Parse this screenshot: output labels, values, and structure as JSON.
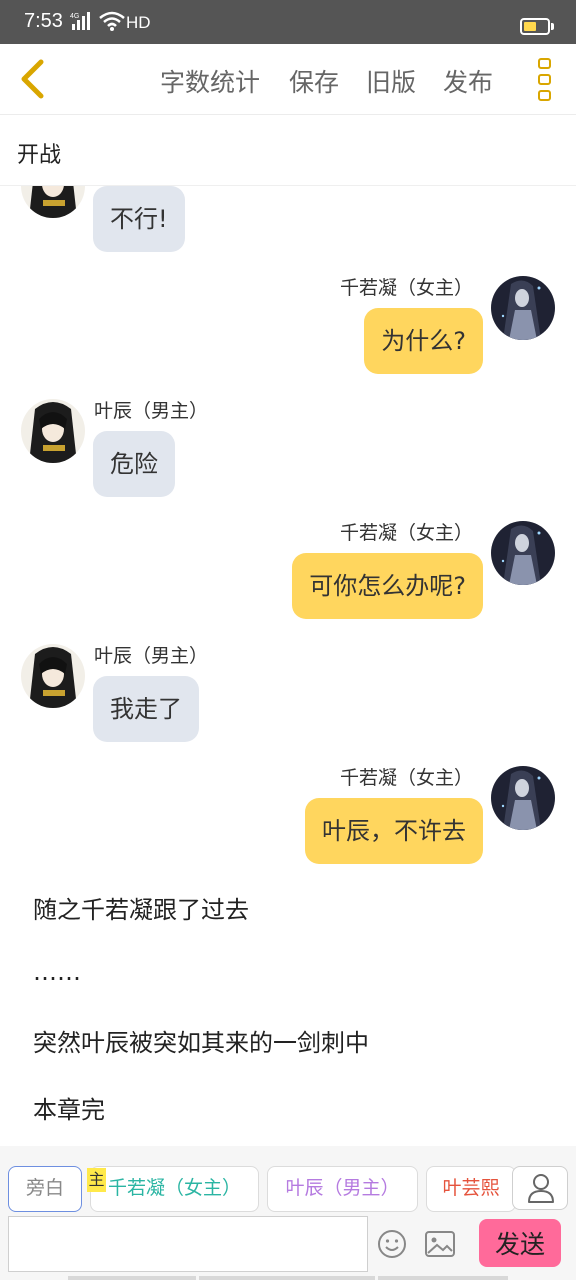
{
  "status_bar": {
    "time": "7:53",
    "network": "HD",
    "battery_level": 0.55,
    "accent": "#ffd84d"
  },
  "toolbar": {
    "actions": [
      "字数统计",
      "保存",
      "旧版",
      "发布"
    ],
    "accent": "#d9a600",
    "back_icon": "chevron-left-icon",
    "menu_icon": "more-vertical-icon"
  },
  "chapter": {
    "title": "开战"
  },
  "messages": [
    {
      "side": "left",
      "sender": "",
      "text": "不行!"
    },
    {
      "side": "right",
      "sender": "千若凝（女主）",
      "text": "为什么?"
    },
    {
      "side": "left",
      "sender": "叶辰（男主）",
      "text": "危险"
    },
    {
      "side": "right",
      "sender": "千若凝（女主）",
      "text": "可你怎么办呢?"
    },
    {
      "side": "left",
      "sender": "叶辰（男主）",
      "text": "我走了"
    },
    {
      "side": "right",
      "sender": "千若凝（女主）",
      "text": "叶辰，不许去"
    }
  ],
  "narration": [
    "随之千若凝跟了过去",
    "……",
    "突然叶辰被突如其来的一剑刺中",
    "本章完"
  ],
  "roles": {
    "narrator": "旁白",
    "main_badge": "主",
    "chips": [
      {
        "label": "千若凝（女主）",
        "color": "#2bb5a3"
      },
      {
        "label": "叶辰（男主）",
        "color": "#b57be0"
      },
      {
        "label": "叶芸熙",
        "color": "#e5533c"
      }
    ]
  },
  "composer": {
    "text": "",
    "placeholder": "",
    "send_label": "发送",
    "send_color": "#ff6a9a"
  }
}
